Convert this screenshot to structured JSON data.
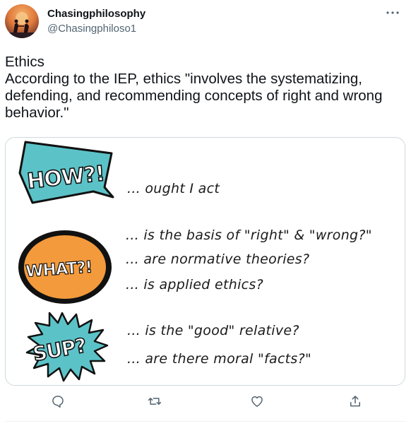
{
  "author": {
    "display_name": "Chasingphilosophy",
    "handle": "@Chasingphiloso1"
  },
  "menu_icon": "more-horizontal-icon",
  "tweet": {
    "lines": [
      "Ethics",
      "According to the IEP, ethics \"involves the systematizing, defending, and recommending concepts of right and wrong behavior.\""
    ]
  },
  "media": {
    "badges": [
      "HOW?!",
      "WHAT?!",
      "SUP?"
    ],
    "groups": [
      {
        "lines": [
          "... ought I act"
        ]
      },
      {
        "lines": [
          "... is the basis of \"right\" & \"wrong?\"",
          "... are normative theories?",
          "... is applied ethics?"
        ]
      },
      {
        "lines": [
          "... is the \"good\" relative?",
          "... are there moral \"facts?\""
        ]
      }
    ],
    "colors": {
      "how": "#5bc3c8",
      "what": "#f39a3c",
      "sup": "#5bc3c8"
    }
  },
  "actions": [
    "reply-icon",
    "retweet-icon",
    "like-icon",
    "share-icon"
  ],
  "colors": {
    "text": "#0f1419",
    "secondary": "#536471",
    "border": "#cfd9de",
    "accent": "#1d9bf0"
  }
}
